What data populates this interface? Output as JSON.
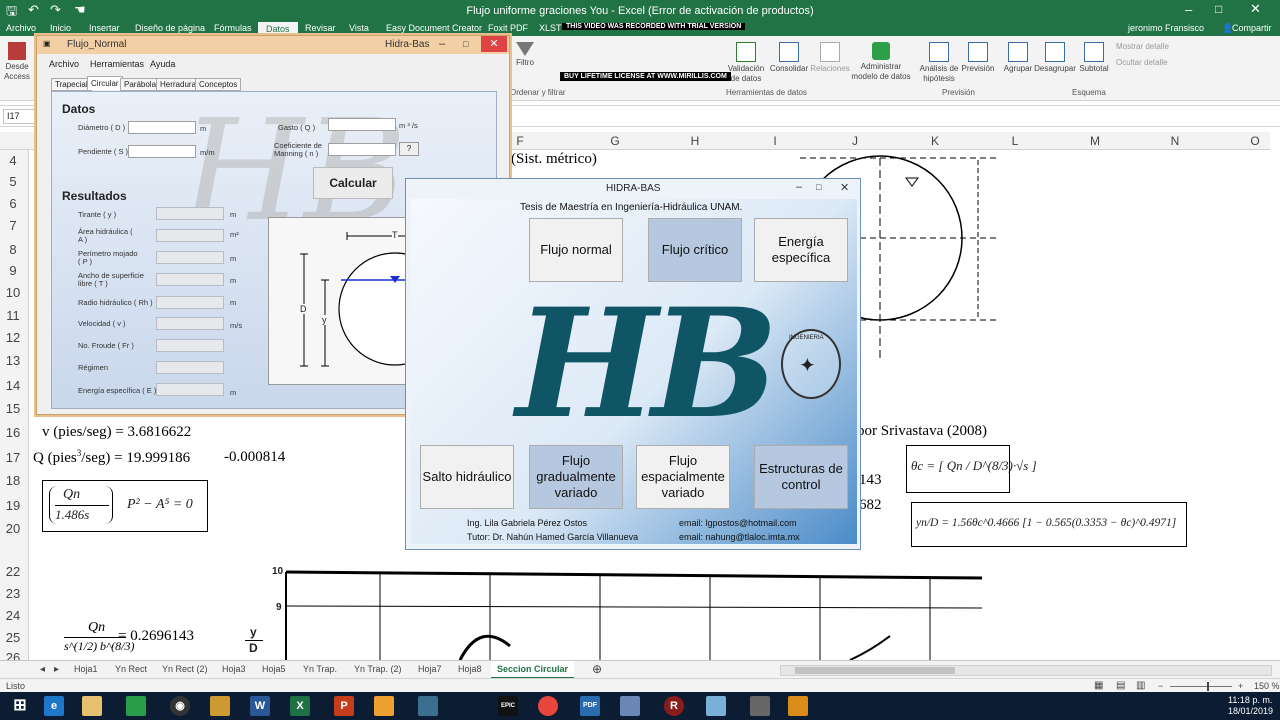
{
  "excel": {
    "title": "Flujo uniforme graciones You - Excel (Error de activación de productos)",
    "user": "jeronimo Fransisco",
    "share": "Compartir",
    "recording_banner_1": "THIS VIDEO WAS RECORDED WITH TRIAL VERSION",
    "recording_banner_2": "BUY LIFETIME LICENSE AT WWW.MIRILLIS.COM",
    "tabs": [
      "Archivo",
      "Inicio",
      "Insertar",
      "Diseño de página",
      "Fórmulas",
      "Datos",
      "Revisar",
      "Vista",
      "Easy Document Creator",
      "Foxit PDF",
      "XLST"
    ],
    "ribbon": {
      "desde_access": "Desde Access",
      "filtro": "Filtro",
      "texto_en_columnas": "Texto en columnas",
      "relleno_rapido": "Relleno rápido",
      "quitar_duplicados": "Quitar duplicados",
      "validacion": "Validación de datos",
      "consolidar": "Consolidar",
      "relaciones": "Relaciones",
      "administrar": "Administrar modelo de datos",
      "analisis": "Análisis de hipótesis",
      "prevision": "Previsión",
      "agrupar": "Agrupar",
      "desagrupar": "Desagrupar",
      "subtotal": "Subtotal",
      "mostrar_detalle": "Mostrar detalle",
      "ocultar_detalle": "Ocultar detalle",
      "grp_ordenar": "Ordenar y filtrar",
      "grp_herramientas": "Herramientas de datos",
      "grp_prevision": "Previsión",
      "grp_esquema": "Esquema"
    },
    "name_box": "I17",
    "columns": [
      "F",
      "G",
      "H",
      "I",
      "J",
      "K",
      "L",
      "M",
      "N",
      "O"
    ],
    "rows": [
      "4",
      "5",
      "6",
      "7",
      "8",
      "9",
      "10",
      "11",
      "12",
      "13",
      "14",
      "15",
      "16",
      "17",
      "18",
      "19",
      "20",
      "22",
      "23",
      "24",
      "25",
      "26"
    ],
    "cells": {
      "sist_metrico": "(Sist. métrico)",
      "v_pies": "v (pies/seg) = 3.6816622",
      "q_label": "Q (pies",
      "q_sup": "3",
      "q_rest": "/seg) = 19.999186",
      "q_diff": "-0.000814",
      "srivastava": "por Srivastava (2008)",
      "val_143": "143",
      "val_682": "682",
      "ratio_value": "= 0.2696143",
      "eq1_num": "Qn",
      "eq1_den": "1.486s",
      "eq1_rest": "P² − A⁵ = 0",
      "eq_theta": "θc = [ Qn / D^(8/3)·√s ]",
      "eq_yn": "yn/D = 1.56θc^0.4666 [1 − 0.565(0.3353 − θc)^0.4971]",
      "frac_num": "Qn",
      "frac_den": "s^(1/2) b^(8/3)",
      "graph_y_top": "10",
      "graph_y_9": "9",
      "graph_y_label_y": "y",
      "graph_y_label_d": "D"
    },
    "sheet_tabs": [
      "Hoja1",
      "Yn Rect",
      "Yn Rect (2)",
      "Hoja3",
      "Hoja5",
      "Yn Trap.",
      "Yn Trap. (2)",
      "Hoja7",
      "Hoja8",
      "Seccion Circular"
    ],
    "active_sheet": "Seccion Circular",
    "status": "Listo",
    "zoom": "150 %"
  },
  "flujo_normal": {
    "title": "Flujo_Normal",
    "app_name": "Hidra-Bas",
    "menu": [
      "Archivo",
      "Herramientas",
      "Ayuda"
    ],
    "tabs": [
      "Trapecial",
      "Circular",
      "Parábola",
      "Herradura",
      "Conceptos"
    ],
    "active_tab": "Circular",
    "datos_title": "Datos",
    "diametro_label": "Diámetro ( D )",
    "diametro_unit": "m",
    "pendiente_label": "Pendiente ( S )",
    "pendiente_unit": "m/m",
    "gasto_label": "Gasto ( Q )",
    "gasto_unit": "m ³ /s",
    "manning_label": "Coeficiente de Manning ( n )",
    "manning_help": "?",
    "calcular": "Calcular",
    "resultados_title": "Resultados",
    "results": [
      {
        "label": "Tirante ( y )",
        "unit": "m"
      },
      {
        "label": "Área hidráulica ( A )",
        "unit": "m²"
      },
      {
        "label": "Perímetro mojado ( P )",
        "unit": "m"
      },
      {
        "label": "Ancho de superficie libre ( T )",
        "unit": "m"
      },
      {
        "label": "Radio hidráulico ( Rh )",
        "unit": "m"
      },
      {
        "label": "Velocidad ( v )",
        "unit": "m/s"
      },
      {
        "label": "No. Froude ( Fr )",
        "unit": ""
      },
      {
        "label": "Régimen",
        "unit": ""
      },
      {
        "label": "Energía específica ( E )",
        "unit": "m"
      }
    ],
    "diagram_t": "T",
    "diagram_d": "D",
    "diagram_y": "y"
  },
  "hidra_bas": {
    "title": "HIDRA-BAS",
    "subtitle": "Tesis de Maestría en Ingeniería-Hidráulica UNAM.",
    "buttons_top": [
      "Flujo normal",
      "Flujo crítico",
      "Energía específica"
    ],
    "buttons_bottom": [
      "Salto hidráulico",
      "Flujo gradualmente variado",
      "Flujo espacialmente variado",
      "Estructuras de control"
    ],
    "logo_text": "HB",
    "seal_text": "INGENIERIA",
    "author": "Ing. Lila Gabriela Pérez Ostos",
    "author_email": "email: lgpostos@hotmail.com",
    "tutor": "Tutor: Dr. Nahún Hamed García Villanueva",
    "tutor_email": "email: nahung@tlaloc.imta.mx"
  },
  "taskbar": {
    "time": "11:18 p. m.",
    "date": "18/01/2019"
  }
}
